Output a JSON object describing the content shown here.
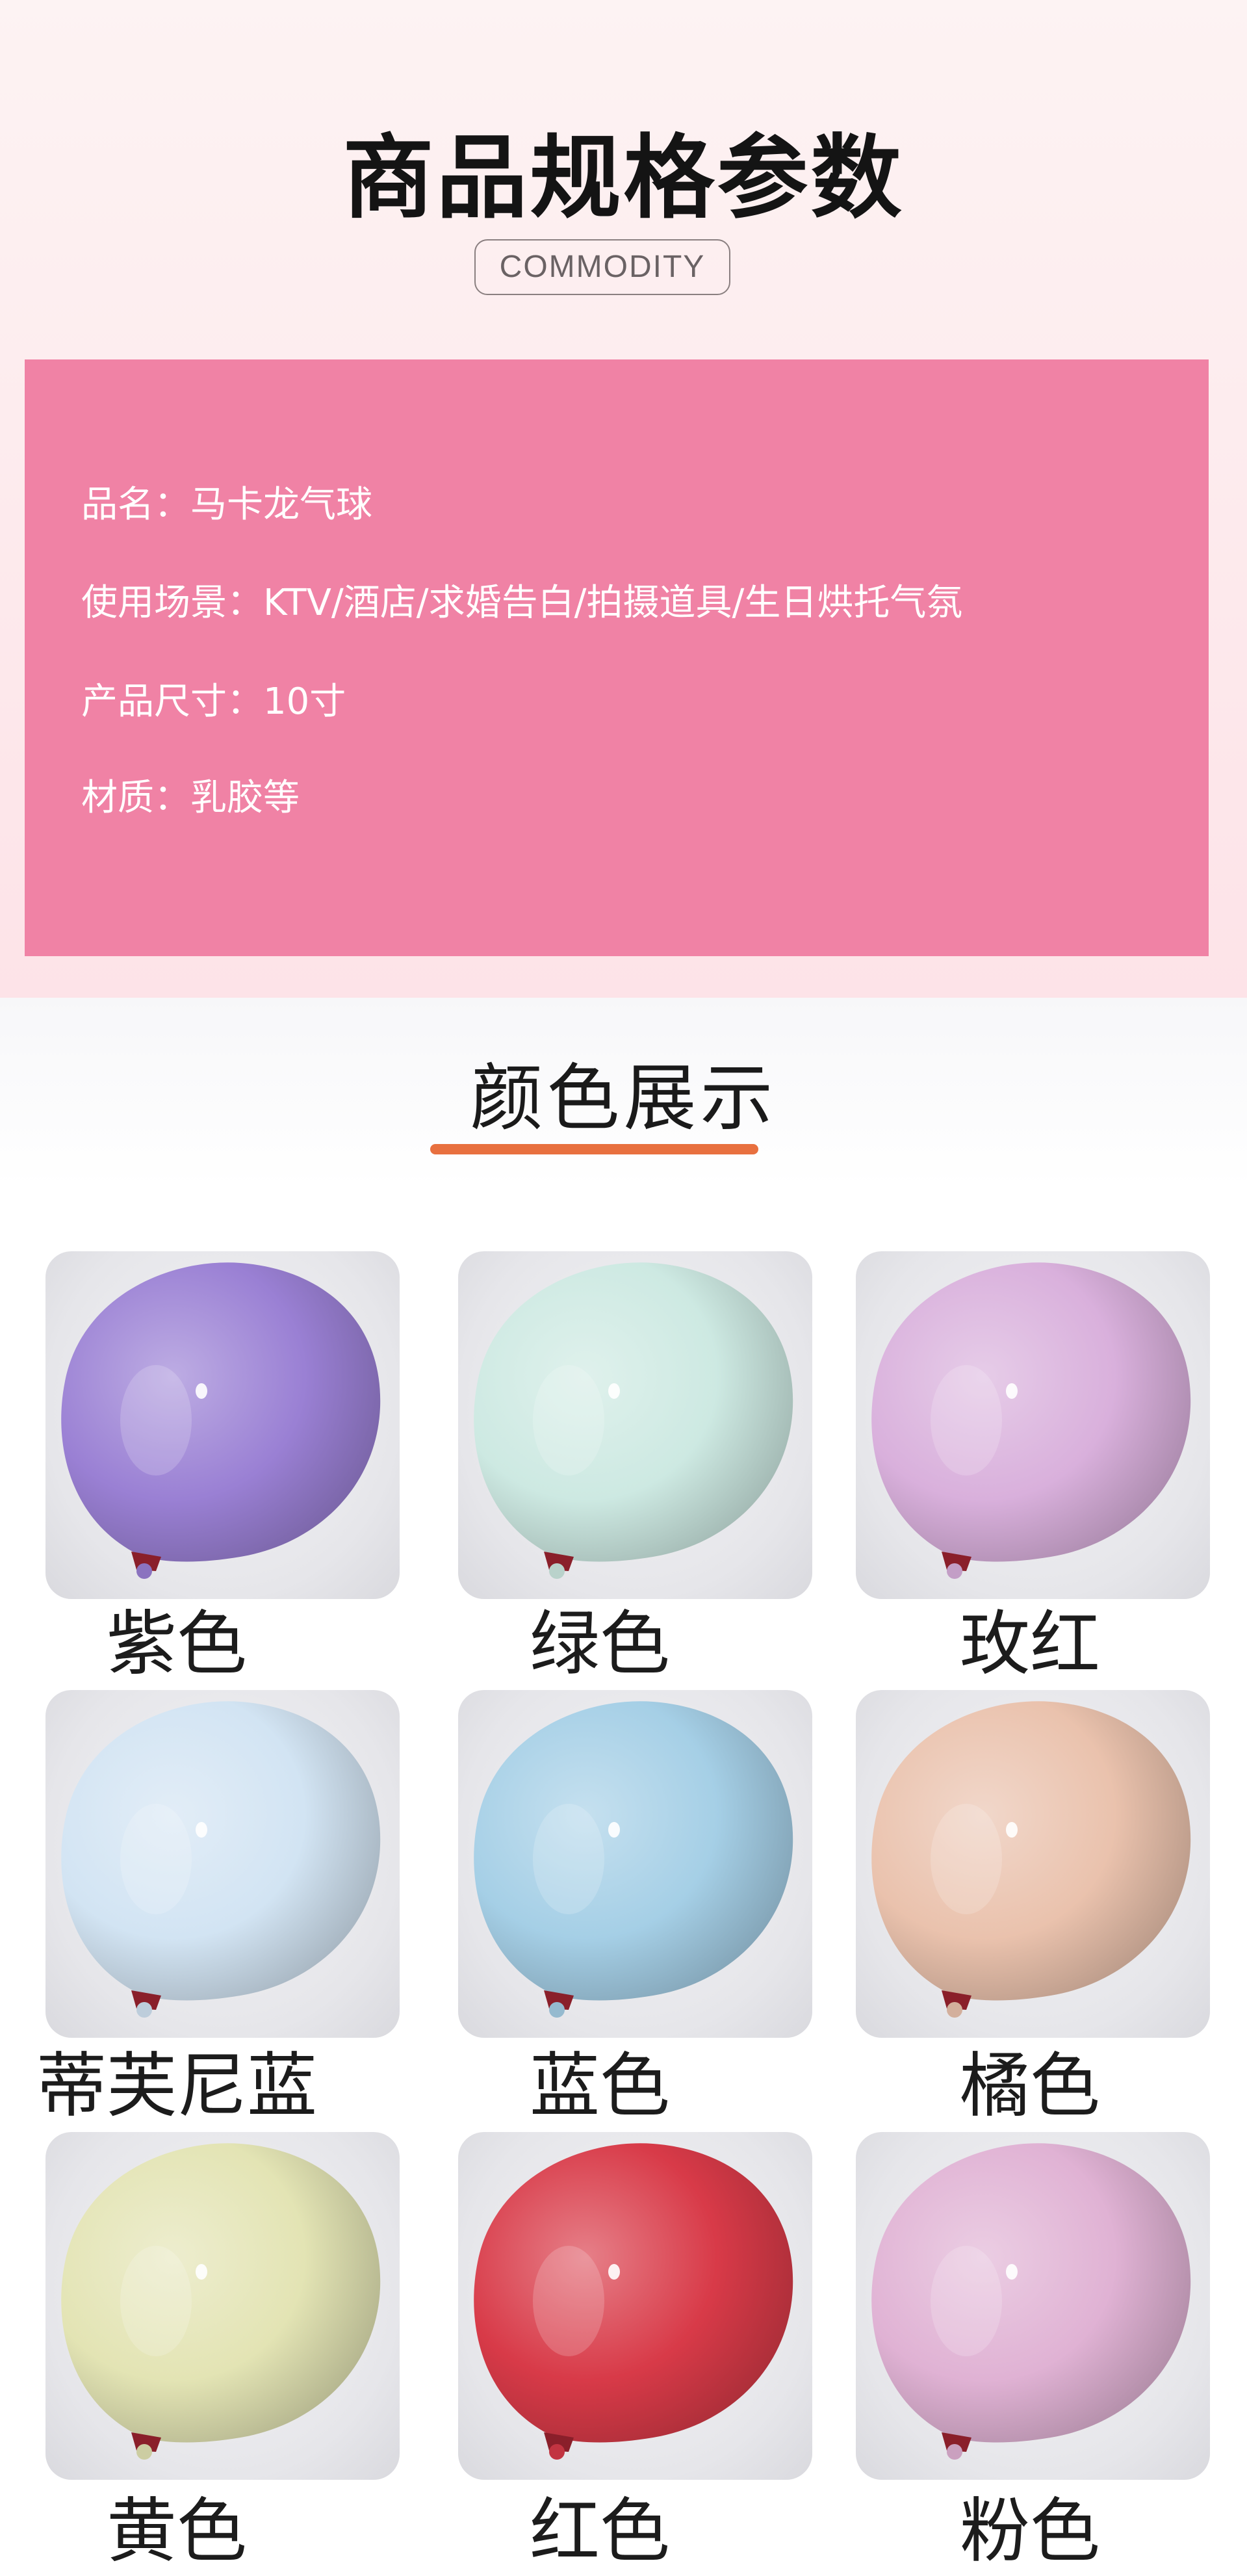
{
  "spec": {
    "title": "商品规格参数",
    "badge": "COMMODITY",
    "rows": [
      {
        "key": "品名：",
        "value": "马卡龙气球"
      },
      {
        "key": "使用场景：",
        "value": "KTV/酒店/求婚告白/拍摄道具/生日烘托气氛"
      },
      {
        "key": "产品尺寸：",
        "value": "10寸"
      },
      {
        "key": "材质：",
        "value": "乳胶等"
      }
    ]
  },
  "colors": {
    "title": "颜色展示",
    "accent_color": "#e8703f",
    "items": [
      {
        "label": "紫色",
        "color": "#9a80d4",
        "icon": "purple-balloon-icon"
      },
      {
        "label": "绿色",
        "color": "#cde9e2",
        "icon": "green-balloon-icon"
      },
      {
        "label": "玫红",
        "color": "#d9b0dc",
        "icon": "rose-balloon-icon"
      },
      {
        "label": "蒂芙尼蓝",
        "color": "#d2e4f3",
        "icon": "tiffany-blue-balloon-icon"
      },
      {
        "label": "蓝色",
        "color": "#a5cfe6",
        "icon": "blue-balloon-icon"
      },
      {
        "label": "橘色",
        "color": "#eac2ad",
        "icon": "orange-balloon-icon"
      },
      {
        "label": "黄色",
        "color": "#e3e4b4",
        "icon": "yellow-balloon-icon"
      },
      {
        "label": "红色",
        "color": "#d83a48",
        "icon": "red-balloon-icon"
      },
      {
        "label": "粉色",
        "color": "#e0b2d4",
        "icon": "pink-balloon-icon"
      }
    ]
  }
}
